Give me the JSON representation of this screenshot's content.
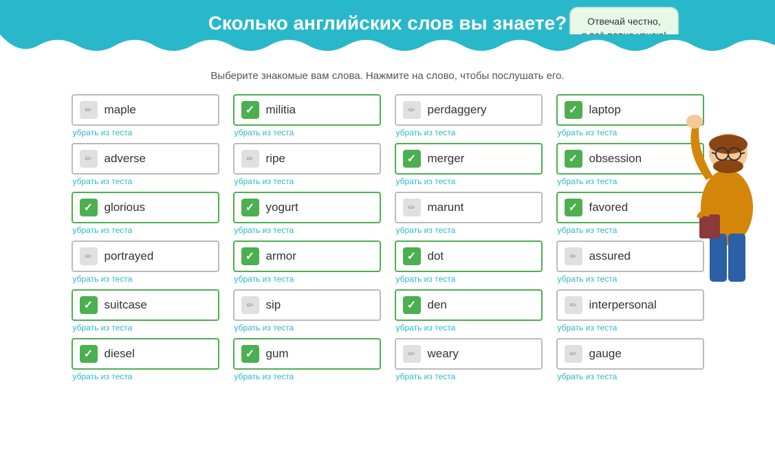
{
  "header": {
    "title": "Сколько английских слов вы знаете?",
    "bubble_line1": "Отвечай честно,",
    "bubble_line2": "я всё равно узнаю!"
  },
  "subtitle": "Выберите знакомые вам слова. Нажмите на слово, чтобы послушать его.",
  "remove_label": "убрать из теста",
  "words": [
    {
      "word": "maple",
      "checked": false
    },
    {
      "word": "militia",
      "checked": true
    },
    {
      "word": "perdaggery",
      "checked": false
    },
    {
      "word": "laptop",
      "checked": true
    },
    {
      "word": "adverse",
      "checked": false
    },
    {
      "word": "ripe",
      "checked": false
    },
    {
      "word": "merger",
      "checked": true
    },
    {
      "word": "obsession",
      "checked": true
    },
    {
      "word": "glorious",
      "checked": true
    },
    {
      "word": "yogurt",
      "checked": true
    },
    {
      "word": "marunt",
      "checked": false
    },
    {
      "word": "favored",
      "checked": true
    },
    {
      "word": "portrayed",
      "checked": false
    },
    {
      "word": "armor",
      "checked": true
    },
    {
      "word": "dot",
      "checked": true
    },
    {
      "word": "assured",
      "checked": false
    },
    {
      "word": "suitcase",
      "checked": true
    },
    {
      "word": "sip",
      "checked": false
    },
    {
      "word": "den",
      "checked": true
    },
    {
      "word": "interpersonal",
      "checked": false
    },
    {
      "word": "diesel",
      "checked": true
    },
    {
      "word": "gum",
      "checked": true
    },
    {
      "word": "weary",
      "checked": false
    },
    {
      "word": "gauge",
      "checked": false
    }
  ]
}
